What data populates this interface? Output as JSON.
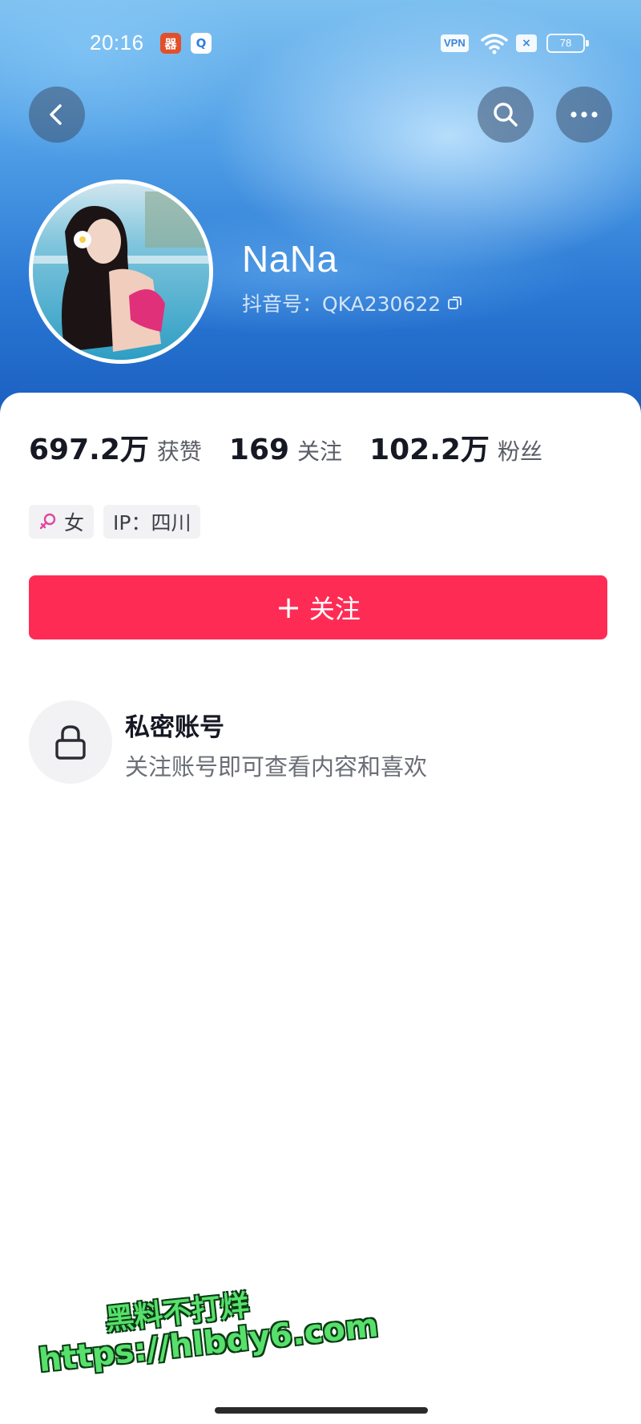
{
  "status_bar": {
    "time": "20:16",
    "app_icon_a": "器",
    "app_icon_b": "Q",
    "vpn_label": "VPN",
    "x_label": "×",
    "battery": "78"
  },
  "profile": {
    "nickname": "NaNa",
    "douyin_id": "抖音号：QKA230622"
  },
  "stats": [
    {
      "value": "697.2万",
      "label": "获赞"
    },
    {
      "value": "169",
      "label": "关注"
    },
    {
      "value": "102.2万",
      "label": "粉丝"
    }
  ],
  "tags": {
    "gender": "女",
    "ip": "IP：四川"
  },
  "follow_button": {
    "plus": "+",
    "label": "关注"
  },
  "private_account": {
    "title": "私密账号",
    "description": "关注账号即可查看内容和喜欢"
  },
  "watermark": {
    "line1": "黑料不打烊",
    "line2": "https://hlbdy6.com"
  },
  "colors": {
    "accent": "#fe2c55",
    "header_blue": "#2a78d4",
    "watermark_green": "#57e06b"
  }
}
